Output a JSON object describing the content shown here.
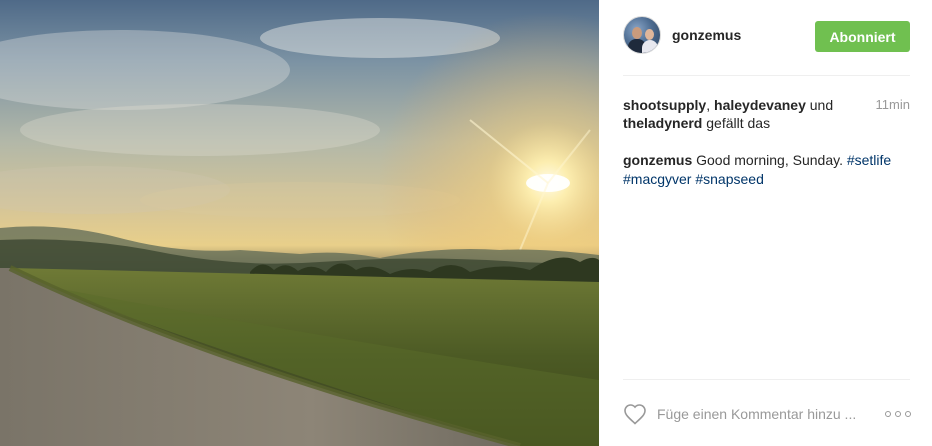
{
  "post": {
    "photo_description": "photo",
    "author": {
      "username": "gonzemus",
      "follow_label": "Abonniert",
      "follow_color": "#70c050"
    },
    "likes": {
      "user1": "shootsupply",
      "separator": ", ",
      "user2": "haleydevaney",
      "connector": " und ",
      "user3": "theladynerd",
      "suffix": " gefällt das"
    },
    "timestamp": "11min",
    "caption": {
      "username": "gonzemus",
      "text": " Good morning, Sunday. ",
      "hashtags": [
        "#setlife",
        "#macgyver",
        "#snapseed"
      ],
      "hashtag_color": "#003569"
    },
    "comment": {
      "placeholder": "Füge einen Kommentar hinzu ...",
      "like_icon": "heart-outline-icon",
      "more_icon": "more-options-icon"
    }
  }
}
